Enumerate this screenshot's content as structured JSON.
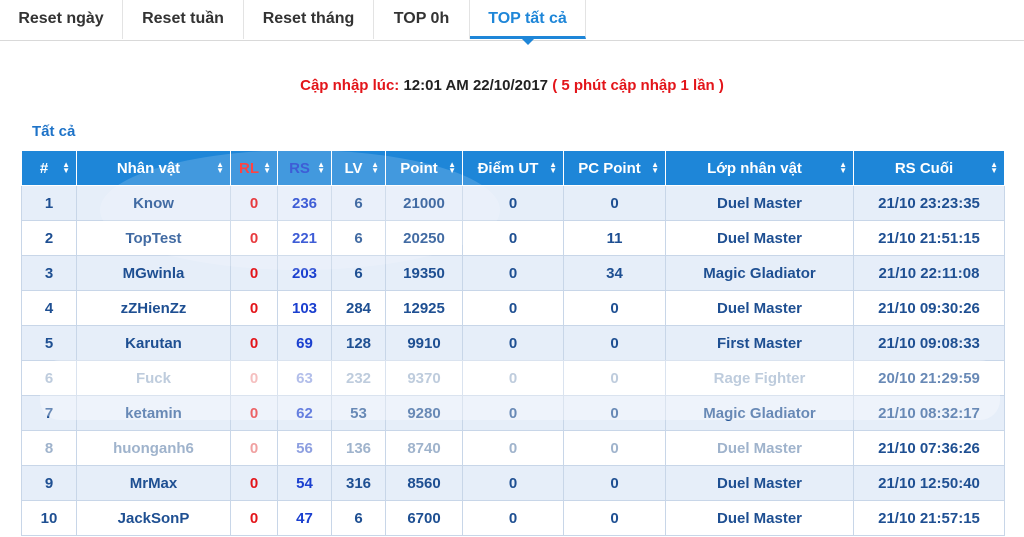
{
  "tabs": [
    {
      "label": "Reset ngày",
      "active": false
    },
    {
      "label": "Reset tuần",
      "active": false
    },
    {
      "label": "Reset tháng",
      "active": false
    },
    {
      "label": "TOP 0h",
      "active": false
    },
    {
      "label": "TOP tất cả",
      "active": true
    }
  ],
  "update": {
    "prefix": "Cập nhập lúc:",
    "time": "12:01 AM 22/10/2017",
    "suffix": "( 5 phút cập nhập 1 lần )"
  },
  "filter_label": "Tất cả",
  "table": {
    "headers": [
      "#",
      "Nhân vật",
      "RL",
      "RS",
      "LV",
      "Point",
      "Điểm UT",
      "PC Point",
      "Lớp nhân vật",
      "RS Cuối"
    ],
    "rows": [
      [
        "1",
        "Know",
        "0",
        "236",
        "6",
        "21000",
        "0",
        "0",
        "Duel Master",
        "21/10 23:23:35"
      ],
      [
        "2",
        "TopTest",
        "0",
        "221",
        "6",
        "20250",
        "0",
        "11",
        "Duel Master",
        "21/10 21:51:15"
      ],
      [
        "3",
        "MGwinla",
        "0",
        "203",
        "6",
        "19350",
        "0",
        "34",
        "Magic Gladiator",
        "21/10 22:11:08"
      ],
      [
        "4",
        "zZHienZz",
        "0",
        "103",
        "284",
        "12925",
        "0",
        "0",
        "Duel Master",
        "21/10 09:30:26"
      ],
      [
        "5",
        "Karutan",
        "0",
        "69",
        "128",
        "9910",
        "0",
        "0",
        "First Master",
        "21/10 09:08:33"
      ],
      [
        "6",
        "Fuck",
        "0",
        "63",
        "232",
        "9370",
        "0",
        "0",
        "Rage Fighter",
        "20/10 21:29:59"
      ],
      [
        "7",
        "ketamin",
        "0",
        "62",
        "53",
        "9280",
        "0",
        "0",
        "Magic Gladiator",
        "21/10 08:32:17"
      ],
      [
        "8",
        "huonganh6",
        "0",
        "56",
        "136",
        "8740",
        "0",
        "0",
        "Duel Master",
        "21/10 07:36:26"
      ],
      [
        "9",
        "MrMax",
        "0",
        "54",
        "316",
        "8560",
        "0",
        "0",
        "Duel Master",
        "21/10 12:50:40"
      ],
      [
        "10",
        "JackSonP",
        "0",
        "47",
        "6",
        "6700",
        "0",
        "0",
        "Duel Master",
        "21/10 21:57:15"
      ]
    ]
  },
  "colors": {
    "accent": "#1e86d8",
    "rl_red": "#e3151a",
    "rs_blue": "#1a3fcf"
  }
}
